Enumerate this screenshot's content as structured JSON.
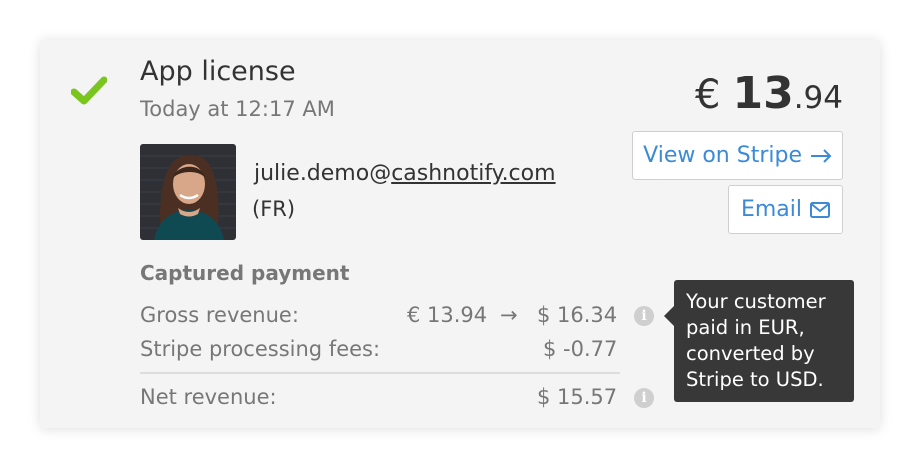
{
  "charge": {
    "title": "App license",
    "timestamp": "Today at 12:17 AM",
    "price_currency": "€",
    "price_whole": "13",
    "price_decimal": ".94"
  },
  "actions": {
    "view_on_stripe": "View on Stripe",
    "email": "Email"
  },
  "customer": {
    "email_user": "julie.demo@",
    "email_domain": "cashnotify.com",
    "country": "(FR)"
  },
  "payment": {
    "section_title": "Captured payment",
    "gross_label": "Gross revenue:",
    "gross_original": "€ 13.94",
    "gross_arrow": "→",
    "gross_converted": "$ 16.34",
    "fees_label": "Stripe processing fees:",
    "fees_value": "$ -0.77",
    "net_label": "Net revenue:",
    "net_value": "$ 15.57"
  },
  "tooltip": {
    "text": "Your customer paid in EUR, converted by Stripe to USD."
  },
  "icons": {
    "status": "checkmark-icon",
    "stripe_arrow": "arrow-right-icon",
    "email": "envelope-icon",
    "info": "info-icon"
  },
  "colors": {
    "success": "#7ac51e",
    "link": "#3a8ad8",
    "tooltip_bg": "#383838"
  }
}
